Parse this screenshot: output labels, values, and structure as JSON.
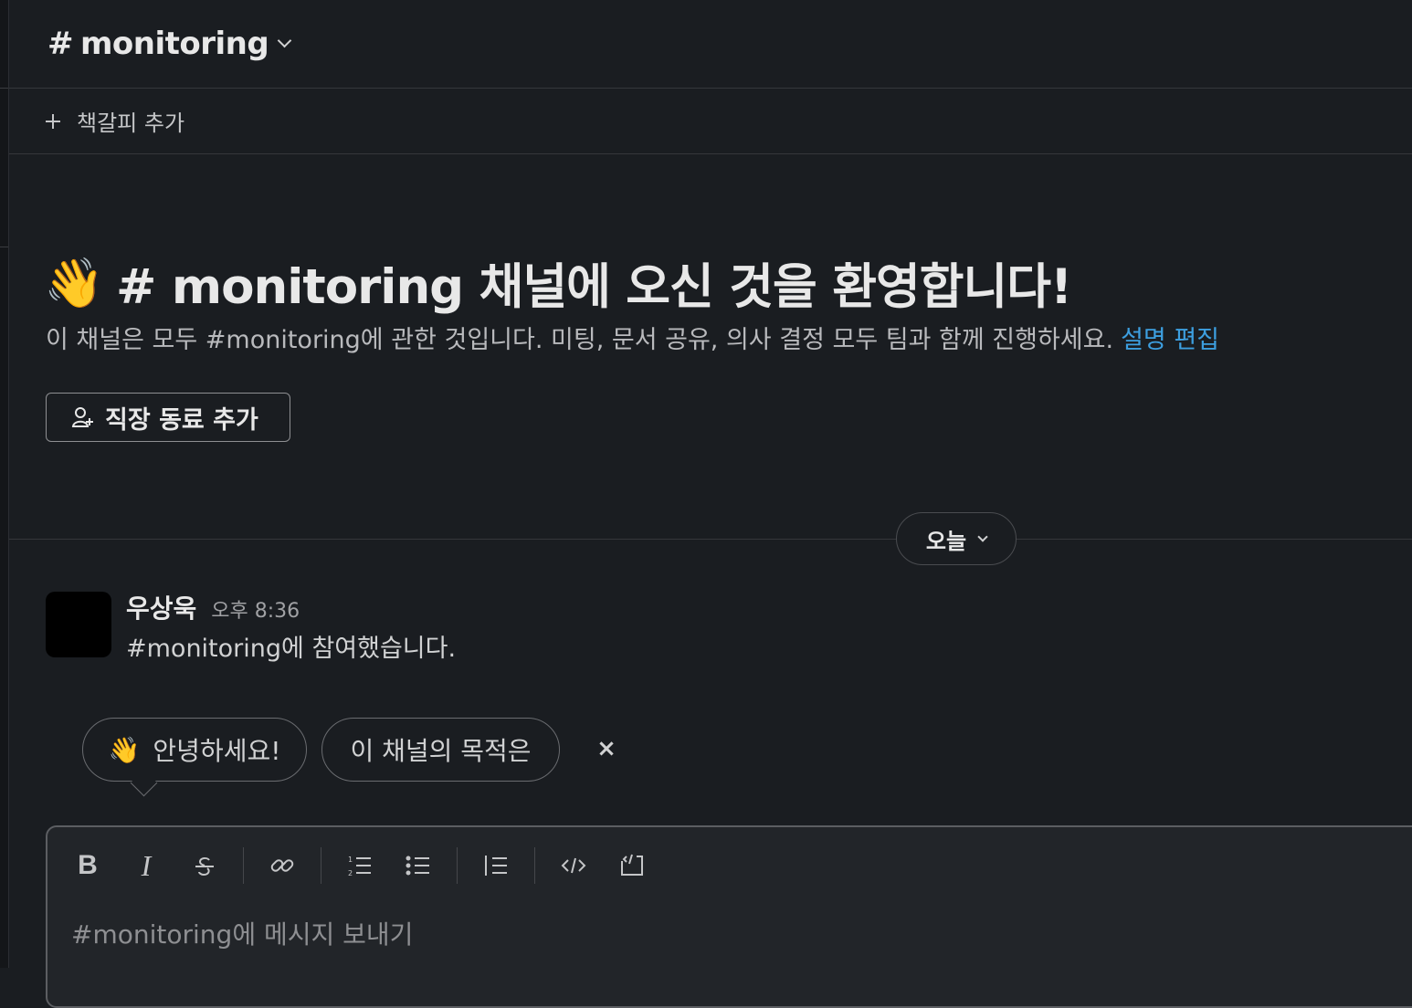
{
  "channel": {
    "hash": "#",
    "name": "monitoring"
  },
  "bookmarks": {
    "add_label": "책갈피 추가"
  },
  "welcome": {
    "emoji": "👋",
    "title": "# monitoring 채널에 오신 것을 환영합니다!",
    "description": "이 채널은 모두 #monitoring에 관한 것입니다. 미팅, 문서 공유, 의사 결정 모두 팀과 함께 진행하세요.",
    "edit_link": "설명 편집",
    "add_coworker_label": "직장 동료 추가"
  },
  "day_divider": {
    "label": "오늘"
  },
  "message": {
    "author": "우상욱",
    "time": "오후 8:36",
    "text": "#monitoring에 참여했습니다."
  },
  "suggestions": {
    "items": [
      {
        "emoji": "👋",
        "label": "안녕하세요!"
      },
      {
        "label": "이 채널의 목적은"
      }
    ],
    "dismiss": "×"
  },
  "composer": {
    "placeholder": "#monitoring에 메시지 보내기",
    "tools": [
      "bold-icon",
      "italic-icon",
      "strikethrough-icon",
      "link-icon",
      "ordered-list-icon",
      "bullet-list-icon",
      "blockquote-icon",
      "code-icon",
      "code-block-icon"
    ]
  },
  "colors": {
    "background": "#1a1d21",
    "link": "#3d9fe0",
    "border": "#35373b"
  }
}
